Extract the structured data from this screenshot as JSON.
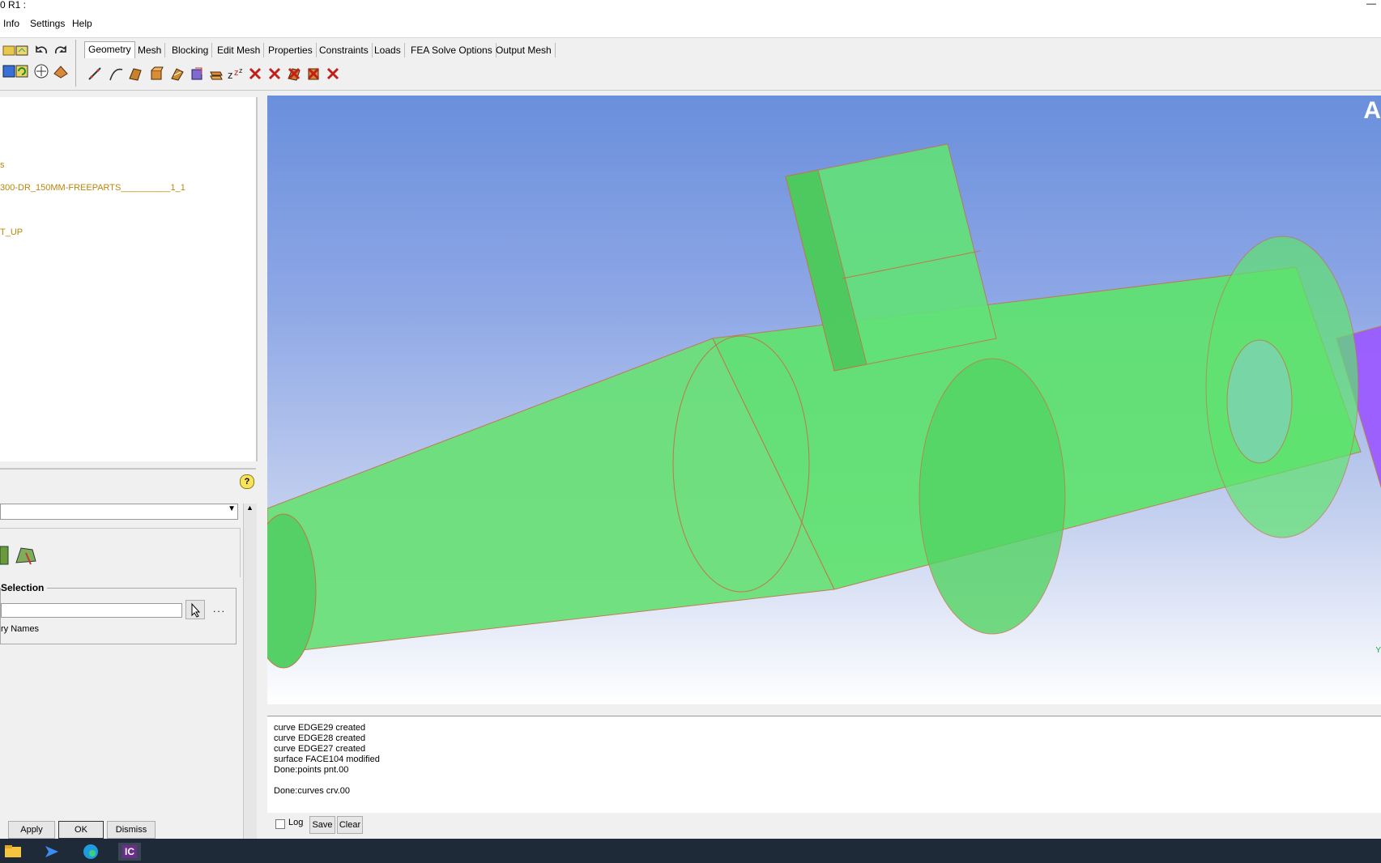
{
  "titlebar": {
    "title": "0 R1 :",
    "minimize": "—"
  },
  "menu": [
    "Info",
    "Settings",
    "Help"
  ],
  "tabs": [
    "Geometry",
    "Mesh",
    "Blocking",
    "Edit Mesh",
    "Properties",
    "Constraints",
    "Loads",
    "FEA Solve Options",
    "Output Mesh"
  ],
  "tree": {
    "item1": "s",
    "item2": "300-DR_150MM-FREEPARTS__________1_1",
    "item3": "T_UP"
  },
  "form": {
    "help": "?",
    "section": "Selection",
    "names_label": "ry Names",
    "browse_dots": "...",
    "input_value": ""
  },
  "buttons": {
    "apply": "Apply",
    "ok": "OK",
    "dismiss": "Dismiss"
  },
  "viewport": {
    "corner_label": "A",
    "axis_label": "Y"
  },
  "messages": [
    "curve EDGE29 created",
    "curve EDGE28 created",
    "curve EDGE27 created",
    "surface FACE104 modified",
    "Done:points pnt.00",
    "",
    "Done:curves crv.00"
  ],
  "msgbar": {
    "log": "Log",
    "save": "Save",
    "clear": "Clear"
  },
  "taskbar": [
    "file-explorer-icon",
    "mail-icon",
    "edge-icon",
    "icem-icon"
  ],
  "taskbar_ic_label": "IC",
  "colors": {
    "geometry": "#5fe36f",
    "pipe": "#9b5cff",
    "curve": "#d08a30",
    "tree_text": "#b8860b"
  }
}
